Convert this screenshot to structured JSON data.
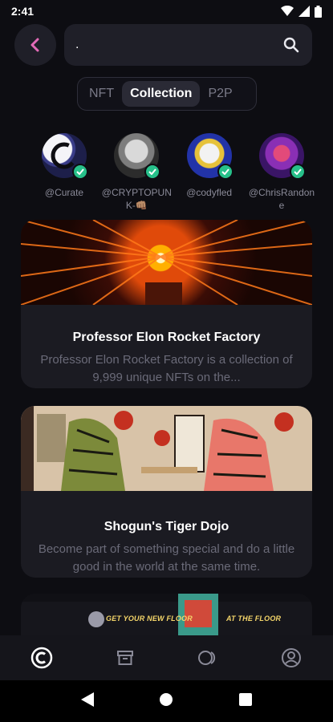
{
  "status": {
    "time": "2:41"
  },
  "search": {
    "value": "."
  },
  "tabs": [
    {
      "label": "NFT",
      "active": false
    },
    {
      "label": "Collection",
      "active": true
    },
    {
      "label": "P2P",
      "active": false
    }
  ],
  "creators": [
    {
      "name": "@Curate"
    },
    {
      "name": "@CRYPTOPUNK-👊🏽"
    },
    {
      "name": "@codyfled"
    },
    {
      "name": "@ChrisRandone"
    }
  ],
  "collections": [
    {
      "title": "Professor Elon Rocket Factory",
      "description": "Professor Elon Rocket Factory is a collection of 9,999 unique NFTs on the..."
    },
    {
      "title": "Shogun's Tiger Dojo",
      "description": "Become part of something special and do a little good in the world at the same time."
    }
  ],
  "banner": {
    "left_text": "GET YOUR NEW FLOOR",
    "right_text": "AT THE FLOOR"
  },
  "colors": {
    "background": "#0d0d12",
    "surface": "#1b1b22",
    "accent": "#e36bb8",
    "verified": "#27c08a"
  }
}
